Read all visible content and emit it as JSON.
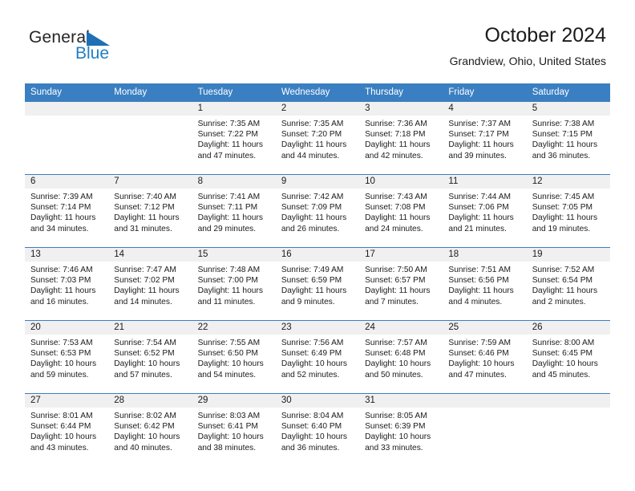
{
  "brand": {
    "name_part1": "General",
    "name_part2": "Blue",
    "flag_icon": "blue-flag-icon",
    "accent_color": "#1f7fc4"
  },
  "header": {
    "title": "October 2024",
    "subtitle": "Grandview, Ohio, United States"
  },
  "calendar": {
    "header_bg": "#3a7fc1",
    "daynum_bg": "#f0f0f0",
    "weekday_headers": [
      "Sunday",
      "Monday",
      "Tuesday",
      "Wednesday",
      "Thursday",
      "Friday",
      "Saturday"
    ],
    "weeks": [
      [
        {
          "day": ""
        },
        {
          "day": ""
        },
        {
          "day": "1",
          "sunrise": "Sunrise: 7:35 AM",
          "sunset": "Sunset: 7:22 PM",
          "daylight_l1": "Daylight: 11 hours",
          "daylight_l2": "and 47 minutes."
        },
        {
          "day": "2",
          "sunrise": "Sunrise: 7:35 AM",
          "sunset": "Sunset: 7:20 PM",
          "daylight_l1": "Daylight: 11 hours",
          "daylight_l2": "and 44 minutes."
        },
        {
          "day": "3",
          "sunrise": "Sunrise: 7:36 AM",
          "sunset": "Sunset: 7:18 PM",
          "daylight_l1": "Daylight: 11 hours",
          "daylight_l2": "and 42 minutes."
        },
        {
          "day": "4",
          "sunrise": "Sunrise: 7:37 AM",
          "sunset": "Sunset: 7:17 PM",
          "daylight_l1": "Daylight: 11 hours",
          "daylight_l2": "and 39 minutes."
        },
        {
          "day": "5",
          "sunrise": "Sunrise: 7:38 AM",
          "sunset": "Sunset: 7:15 PM",
          "daylight_l1": "Daylight: 11 hours",
          "daylight_l2": "and 36 minutes."
        }
      ],
      [
        {
          "day": "6",
          "sunrise": "Sunrise: 7:39 AM",
          "sunset": "Sunset: 7:14 PM",
          "daylight_l1": "Daylight: 11 hours",
          "daylight_l2": "and 34 minutes."
        },
        {
          "day": "7",
          "sunrise": "Sunrise: 7:40 AM",
          "sunset": "Sunset: 7:12 PM",
          "daylight_l1": "Daylight: 11 hours",
          "daylight_l2": "and 31 minutes."
        },
        {
          "day": "8",
          "sunrise": "Sunrise: 7:41 AM",
          "sunset": "Sunset: 7:11 PM",
          "daylight_l1": "Daylight: 11 hours",
          "daylight_l2": "and 29 minutes."
        },
        {
          "day": "9",
          "sunrise": "Sunrise: 7:42 AM",
          "sunset": "Sunset: 7:09 PM",
          "daylight_l1": "Daylight: 11 hours",
          "daylight_l2": "and 26 minutes."
        },
        {
          "day": "10",
          "sunrise": "Sunrise: 7:43 AM",
          "sunset": "Sunset: 7:08 PM",
          "daylight_l1": "Daylight: 11 hours",
          "daylight_l2": "and 24 minutes."
        },
        {
          "day": "11",
          "sunrise": "Sunrise: 7:44 AM",
          "sunset": "Sunset: 7:06 PM",
          "daylight_l1": "Daylight: 11 hours",
          "daylight_l2": "and 21 minutes."
        },
        {
          "day": "12",
          "sunrise": "Sunrise: 7:45 AM",
          "sunset": "Sunset: 7:05 PM",
          "daylight_l1": "Daylight: 11 hours",
          "daylight_l2": "and 19 minutes."
        }
      ],
      [
        {
          "day": "13",
          "sunrise": "Sunrise: 7:46 AM",
          "sunset": "Sunset: 7:03 PM",
          "daylight_l1": "Daylight: 11 hours",
          "daylight_l2": "and 16 minutes."
        },
        {
          "day": "14",
          "sunrise": "Sunrise: 7:47 AM",
          "sunset": "Sunset: 7:02 PM",
          "daylight_l1": "Daylight: 11 hours",
          "daylight_l2": "and 14 minutes."
        },
        {
          "day": "15",
          "sunrise": "Sunrise: 7:48 AM",
          "sunset": "Sunset: 7:00 PM",
          "daylight_l1": "Daylight: 11 hours",
          "daylight_l2": "and 11 minutes."
        },
        {
          "day": "16",
          "sunrise": "Sunrise: 7:49 AM",
          "sunset": "Sunset: 6:59 PM",
          "daylight_l1": "Daylight: 11 hours",
          "daylight_l2": "and 9 minutes."
        },
        {
          "day": "17",
          "sunrise": "Sunrise: 7:50 AM",
          "sunset": "Sunset: 6:57 PM",
          "daylight_l1": "Daylight: 11 hours",
          "daylight_l2": "and 7 minutes."
        },
        {
          "day": "18",
          "sunrise": "Sunrise: 7:51 AM",
          "sunset": "Sunset: 6:56 PM",
          "daylight_l1": "Daylight: 11 hours",
          "daylight_l2": "and 4 minutes."
        },
        {
          "day": "19",
          "sunrise": "Sunrise: 7:52 AM",
          "sunset": "Sunset: 6:54 PM",
          "daylight_l1": "Daylight: 11 hours",
          "daylight_l2": "and 2 minutes."
        }
      ],
      [
        {
          "day": "20",
          "sunrise": "Sunrise: 7:53 AM",
          "sunset": "Sunset: 6:53 PM",
          "daylight_l1": "Daylight: 10 hours",
          "daylight_l2": "and 59 minutes."
        },
        {
          "day": "21",
          "sunrise": "Sunrise: 7:54 AM",
          "sunset": "Sunset: 6:52 PM",
          "daylight_l1": "Daylight: 10 hours",
          "daylight_l2": "and 57 minutes."
        },
        {
          "day": "22",
          "sunrise": "Sunrise: 7:55 AM",
          "sunset": "Sunset: 6:50 PM",
          "daylight_l1": "Daylight: 10 hours",
          "daylight_l2": "and 54 minutes."
        },
        {
          "day": "23",
          "sunrise": "Sunrise: 7:56 AM",
          "sunset": "Sunset: 6:49 PM",
          "daylight_l1": "Daylight: 10 hours",
          "daylight_l2": "and 52 minutes."
        },
        {
          "day": "24",
          "sunrise": "Sunrise: 7:57 AM",
          "sunset": "Sunset: 6:48 PM",
          "daylight_l1": "Daylight: 10 hours",
          "daylight_l2": "and 50 minutes."
        },
        {
          "day": "25",
          "sunrise": "Sunrise: 7:59 AM",
          "sunset": "Sunset: 6:46 PM",
          "daylight_l1": "Daylight: 10 hours",
          "daylight_l2": "and 47 minutes."
        },
        {
          "day": "26",
          "sunrise": "Sunrise: 8:00 AM",
          "sunset": "Sunset: 6:45 PM",
          "daylight_l1": "Daylight: 10 hours",
          "daylight_l2": "and 45 minutes."
        }
      ],
      [
        {
          "day": "27",
          "sunrise": "Sunrise: 8:01 AM",
          "sunset": "Sunset: 6:44 PM",
          "daylight_l1": "Daylight: 10 hours",
          "daylight_l2": "and 43 minutes."
        },
        {
          "day": "28",
          "sunrise": "Sunrise: 8:02 AM",
          "sunset": "Sunset: 6:42 PM",
          "daylight_l1": "Daylight: 10 hours",
          "daylight_l2": "and 40 minutes."
        },
        {
          "day": "29",
          "sunrise": "Sunrise: 8:03 AM",
          "sunset": "Sunset: 6:41 PM",
          "daylight_l1": "Daylight: 10 hours",
          "daylight_l2": "and 38 minutes."
        },
        {
          "day": "30",
          "sunrise": "Sunrise: 8:04 AM",
          "sunset": "Sunset: 6:40 PM",
          "daylight_l1": "Daylight: 10 hours",
          "daylight_l2": "and 36 minutes."
        },
        {
          "day": "31",
          "sunrise": "Sunrise: 8:05 AM",
          "sunset": "Sunset: 6:39 PM",
          "daylight_l1": "Daylight: 10 hours",
          "daylight_l2": "and 33 minutes."
        },
        {
          "day": ""
        },
        {
          "day": ""
        }
      ]
    ]
  }
}
